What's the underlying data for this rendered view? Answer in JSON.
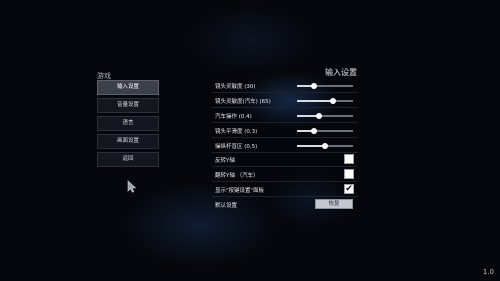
{
  "left_panel": {
    "title": "游戏",
    "menu": [
      {
        "label": "输入设置",
        "active": true
      },
      {
        "label": "音量设置",
        "active": false
      },
      {
        "label": "语言",
        "active": false
      },
      {
        "label": "画面设置",
        "active": false
      },
      {
        "label": "返回",
        "active": false
      }
    ]
  },
  "right_panel": {
    "title": "输入设置",
    "sliders": [
      {
        "label": "镜头灵敏度 (30)",
        "value": 30,
        "max": 100
      },
      {
        "label": "镜头灵敏度(汽车) (65)",
        "value": 65,
        "max": 100
      },
      {
        "label": "汽车操作 (0.4)",
        "value": 0.4,
        "max": 1
      },
      {
        "label": "镜头平滑度 (0.3)",
        "value": 0.3,
        "max": 1
      },
      {
        "label": "操纵杆盲区 (0.5)",
        "value": 0.5,
        "max": 1
      }
    ],
    "checkboxes": [
      {
        "label": "反转Y轴",
        "checked": false
      },
      {
        "label": "翻转Y轴 （汽车）",
        "checked": false
      },
      {
        "label": "显示\"按键设置\"面板",
        "checked": true
      }
    ],
    "reset": {
      "label": "默认设置",
      "button": "恢复"
    }
  },
  "version": "1.0",
  "icons": {
    "cursor": "mouse-cursor-icon",
    "check": "checkmark-icon"
  }
}
